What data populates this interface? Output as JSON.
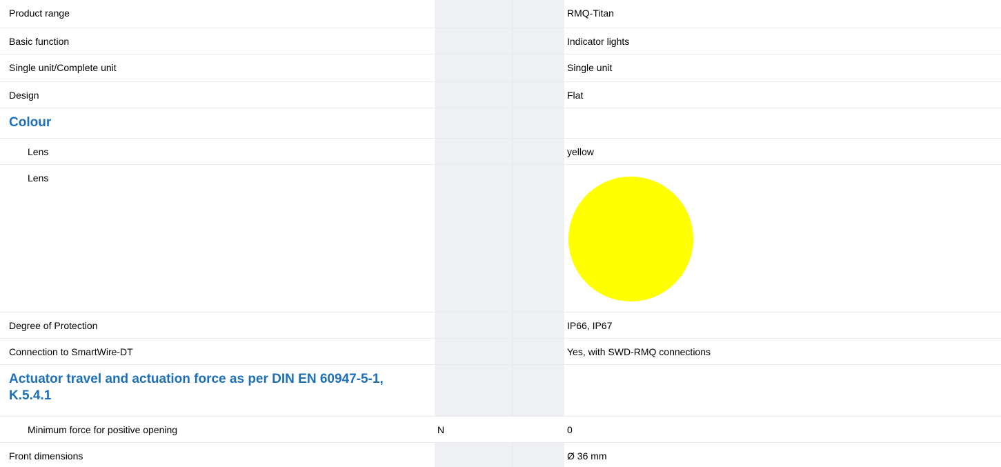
{
  "colors": {
    "heading": "#1d6fb8",
    "shade": "#eef0f3",
    "swatch": "#ffff00"
  },
  "rows": [
    {
      "label": "Product range",
      "unit": "",
      "value": "RMQ-Titan"
    },
    {
      "label": "Basic function",
      "unit": "",
      "value": "Indicator lights"
    },
    {
      "label": "Single unit/Complete unit",
      "unit": "",
      "value": "Single unit"
    },
    {
      "label": "Design",
      "unit": "",
      "value": "Flat"
    },
    {
      "label": "Colour",
      "unit": "",
      "value": ""
    },
    {
      "label": "Lens",
      "unit": "",
      "value": "yellow"
    },
    {
      "label": "Lens",
      "unit": "",
      "value": ""
    },
    {
      "label": "Degree of Protection",
      "unit": "",
      "value": "IP66, IP67"
    },
    {
      "label": "Connection to SmartWire-DT",
      "unit": "",
      "value": "Yes, with SWD-RMQ connections"
    },
    {
      "label": "Actuator travel and actuation force as per DIN EN 60947-5-1, K.5.4.1",
      "unit": "",
      "value": ""
    },
    {
      "label": "Minimum force for positive opening",
      "unit": "N",
      "value": "0"
    },
    {
      "label": "Front dimensions",
      "unit": "",
      "value": "Ø 36 mm"
    }
  ]
}
